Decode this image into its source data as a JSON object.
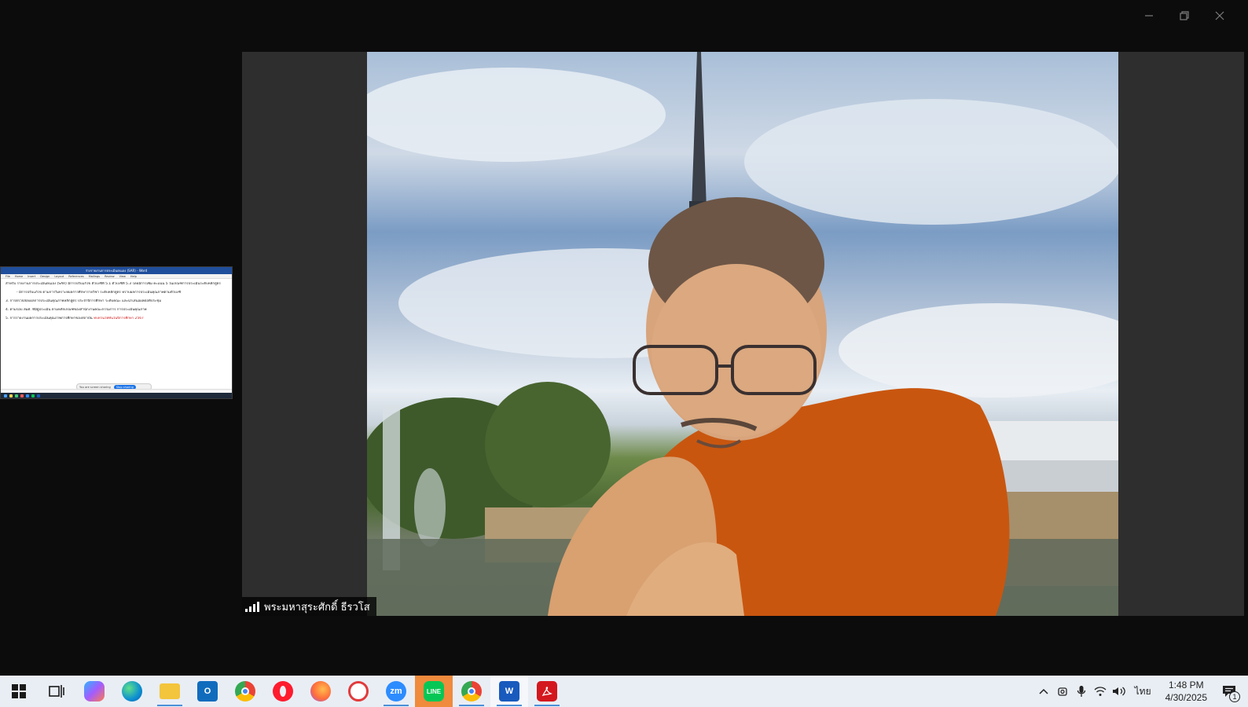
{
  "window": {
    "controls": [
      "minimize",
      "restore",
      "close"
    ]
  },
  "meeting": {
    "participant_name": "พระมหาสุระศักดิ์ ธีรวโส"
  },
  "shared_screen_thumb": {
    "title": "ร่างรายงานการประเมินตนเอง (SAR) - Word",
    "ribbon_tabs": [
      "File",
      "Home",
      "Insert",
      "Design",
      "Layout",
      "References",
      "Mailings",
      "Review",
      "View",
      "Help"
    ],
    "lines": [
      "สำหรับ รายงานการประเมินตนเอง (SAR) มีการปรับแก้ไข ตัวบ่งชี้ที่ 5.1 ตัวบ่งชี้ที่ 5.3 โดยมีการเพิ่ม คะแนน 5 ในเกณฑ์การประเมินระดับหลักสูตร",
      "- มีการปรับแก้ไข ตามการวิเคราะห์ผลการศึกษารายวิชา ระดับหลักสูตร ทราบผลการประเมินคุณภาพตามตัวบ่งชี้",
      "3. การตรวจสอบผลการประเมินคุณภาพหลักสูตร ประจำปีการศึกษา ระดับคณะ และนำเสนอผลต่อที่ประชุม",
      "4. ตามรอบ สมศ. ที่มีผู้ประเมิน ตามหลักเกณฑ์ของสำนักงานคณะกรรมการ การประเมินคุณภาพ",
      "5. การรายงานผลการประเมินคุณภาพการศึกษาของสถาบัน"
    ],
    "red_text": "ทบทวนให้ทันในปีการศึกษา 2567",
    "share_bar_text": "You are screen sharing",
    "stop_label": "Stop sharing"
  },
  "taskbar": {
    "apps": [
      {
        "name": "start",
        "label": "Start"
      },
      {
        "name": "task-view",
        "label": "Task View"
      },
      {
        "name": "copilot",
        "label": "Copilot"
      },
      {
        "name": "edge",
        "label": "Edge"
      },
      {
        "name": "file-explorer",
        "label": "File Explorer"
      },
      {
        "name": "outlook",
        "label": "O"
      },
      {
        "name": "chrome",
        "label": "Chrome"
      },
      {
        "name": "opera",
        "label": "O"
      },
      {
        "name": "firefox",
        "label": "Firefox"
      },
      {
        "name": "app-red",
        "label": "App"
      },
      {
        "name": "zoom",
        "label": "zm"
      },
      {
        "name": "line",
        "label": "LINE"
      },
      {
        "name": "chrome-profile",
        "label": "Chrome"
      },
      {
        "name": "word",
        "label": "W"
      },
      {
        "name": "acrobat",
        "label": "Acrobat"
      }
    ],
    "language": "ไทย",
    "time": "1:48 PM",
    "date": "4/30/2025",
    "notification_count": "1"
  },
  "colors": {
    "background": "#0c0c0d",
    "stage": "#2e2e2e",
    "taskbar": "#e9eef5",
    "zoom_blue": "#2d8cff",
    "line_green": "#06c755",
    "word_blue": "#185abd",
    "robe_orange": "#c9560f"
  }
}
